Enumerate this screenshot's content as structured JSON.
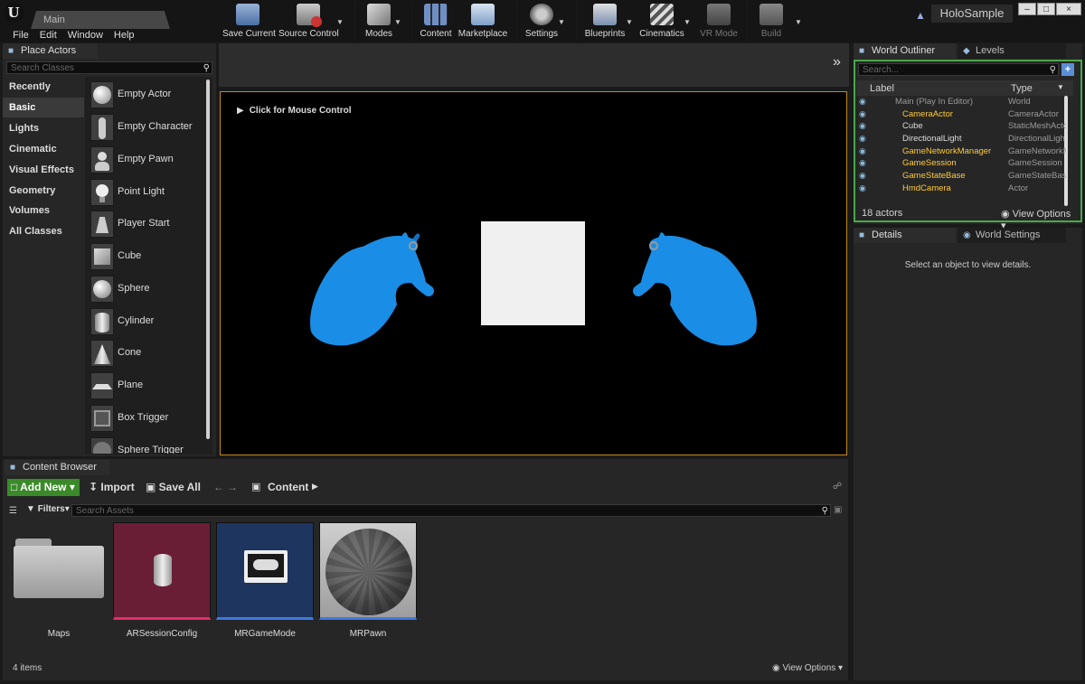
{
  "app": {
    "tab_label": "Main",
    "project_name": "HoloSample",
    "window_buttons": [
      "–",
      "□",
      "×"
    ]
  },
  "menu": [
    "File",
    "Edit",
    "Window",
    "Help"
  ],
  "place_actors": {
    "tab": "Place Actors",
    "search_placeholder": "Search Classes",
    "categories": [
      "Recently Placed",
      "Basic",
      "Lights",
      "Cinematic",
      "Visual Effects",
      "Geometry",
      "Volumes",
      "All Classes"
    ],
    "selected_category": "Basic",
    "actors": [
      "Empty Actor",
      "Empty Character",
      "Empty Pawn",
      "Point Light",
      "Player Start",
      "Cube",
      "Sphere",
      "Cylinder",
      "Cone",
      "Plane",
      "Box Trigger",
      "Sphere Trigger"
    ]
  },
  "toolbar": {
    "buttons": [
      "Save Current",
      "Source Control",
      "Modes",
      "Content",
      "Marketplace",
      "Settings",
      "Blueprints",
      "Cinematics",
      "VR Mode",
      "Build"
    ],
    "more": "»"
  },
  "viewport": {
    "hint": "Click for Mouse Control"
  },
  "outliner": {
    "tab": "World Outliner",
    "tab2": "Levels",
    "search_placeholder": "Search...",
    "col_label": "Label",
    "col_type": "Type",
    "rows": [
      {
        "label": "Main (Play In Editor)",
        "type": "World"
      },
      {
        "label": "CameraActor",
        "type": "CameraActor"
      },
      {
        "label": "Cube",
        "type": "StaticMeshActo"
      },
      {
        "label": "DirectionalLight",
        "type": "DirectionalLigh"
      },
      {
        "label": "GameNetworkManager",
        "type": "GameNetworkM"
      },
      {
        "label": "GameSession",
        "type": "GameSession"
      },
      {
        "label": "GameStateBase",
        "type": "GameStateBase"
      },
      {
        "label": "HmdCamera",
        "type": "Actor"
      }
    ],
    "count": "18 actors",
    "view_options": "View Options"
  },
  "details": {
    "tab": "Details",
    "tab2": "World Settings",
    "empty_text": "Select an object to view details."
  },
  "content_browser": {
    "tab": "Content Browser",
    "add_new": "Add New",
    "import": "Import",
    "save_all": "Save All",
    "path": "Content",
    "filters": "Filters",
    "search_placeholder": "Search Assets",
    "assets": [
      "Maps",
      "ARSessionConfig",
      "MRGameMode",
      "MRPawn"
    ],
    "count": "4 items",
    "view_options": "View Options"
  },
  "colors": {
    "accent_gold": "#c08a1a",
    "add_new_green": "#3a8a2a",
    "hand_blue": "#1a8ee6",
    "outliner_border": "#4aa84a"
  }
}
